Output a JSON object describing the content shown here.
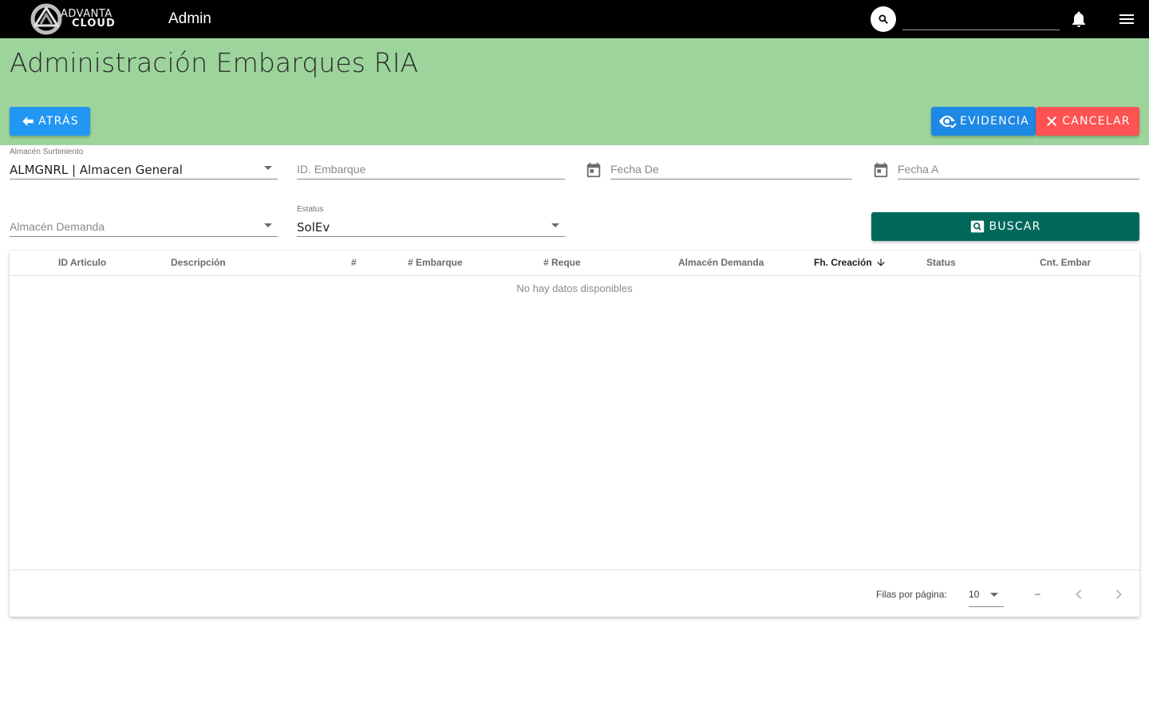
{
  "appbar": {
    "logo_line1": "ADVANTA",
    "logo_line2": "CLOUD",
    "title": "Admin",
    "search_placeholder": ""
  },
  "header": {
    "page_title": "Administración Embarques RIA",
    "back_label": "Atrás",
    "evidence_label": "Evidencia",
    "cancel_label": "Cancelar"
  },
  "filters": {
    "almacen_surtimiento": {
      "label": "Almacén Surtimiento",
      "value": "ALMGNRL | Almacen General"
    },
    "id_embarque": {
      "placeholder": "ID. Embarque"
    },
    "fecha_de": {
      "placeholder": "Fecha De"
    },
    "fecha_a": {
      "placeholder": "Fecha A"
    },
    "almacen_demanda": {
      "placeholder": "Almacén Demanda"
    },
    "estatus": {
      "label": "Estatus",
      "value": "SolEv"
    },
    "search_label": "Buscar"
  },
  "table": {
    "columns": [
      "ID Articulo",
      "Descripción",
      "#",
      "# Embarque",
      "# Reque",
      "Almacén Demanda",
      "Fh. Creación",
      "Status",
      "Cnt. Embar"
    ],
    "sorted_column": "Fh. Creación",
    "empty_text": "No hay datos disponibles",
    "rows": []
  },
  "pagination": {
    "rows_per_page_label": "Filas por página:",
    "rows_per_page": "10",
    "range": "–"
  },
  "colors": {
    "appbar": "#000000",
    "band": "#9cd49c",
    "back_button": "#2196f3",
    "evidence_button": "#1e88e5",
    "cancel_button": "#ff5252",
    "search_button": "#00695c"
  }
}
